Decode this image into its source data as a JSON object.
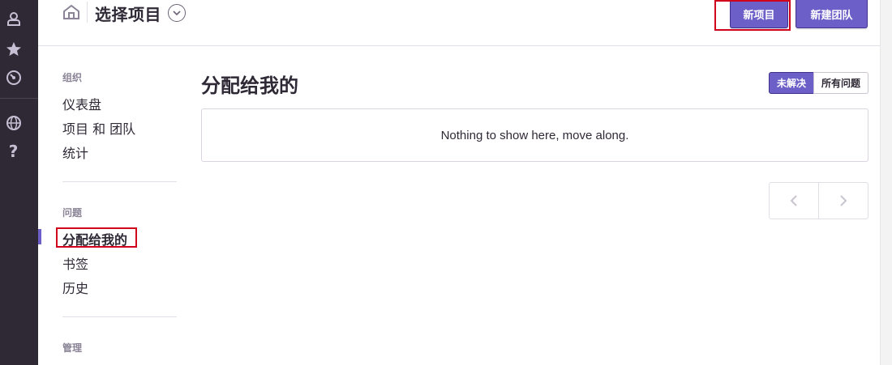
{
  "header": {
    "project_selector_label": "选择项目",
    "new_project_label": "新项目",
    "new_team_label": "新建团队"
  },
  "sidebar": {
    "sections": [
      {
        "heading": "组织",
        "items": [
          "仪表盘",
          "项目 和 团队",
          "统计"
        ]
      },
      {
        "heading": "问题",
        "items": [
          "分配给我的",
          "书签",
          "历史"
        ]
      },
      {
        "heading": "管理",
        "items": []
      }
    ],
    "active_item": "分配给我的"
  },
  "main": {
    "title": "分配给我的",
    "filters": [
      "未解决",
      "所有问题"
    ],
    "active_filter": "未解决",
    "empty_message": "Nothing to show here, move along."
  },
  "rail_icons": [
    "user-icon",
    "star-icon",
    "activity-clock-icon",
    "globe-icon",
    "help-icon"
  ],
  "colors": {
    "accent": "#6c5fc7",
    "rail_bg": "#2f2936",
    "highlight": "#d0021b"
  }
}
